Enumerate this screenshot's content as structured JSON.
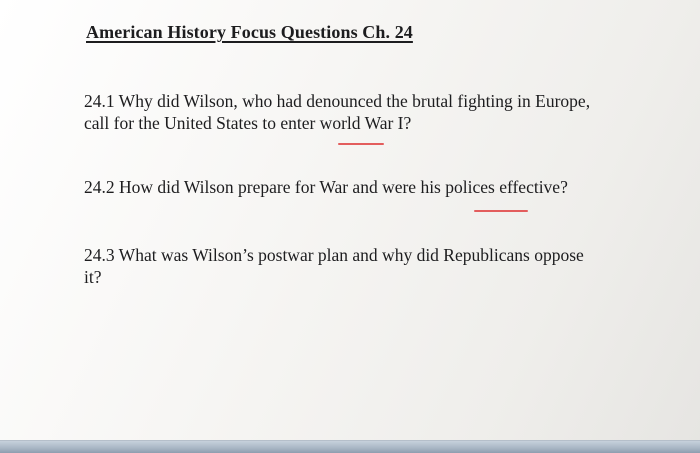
{
  "document": {
    "title": "American History Focus Questions Ch. 24",
    "questions": [
      {
        "text_line1": "24.1 Why did Wilson, who had denounced the brutal fighting in Europe,",
        "text_line2": "call for the United States to enter world War I?"
      },
      {
        "text_line1": "24.2 How did Wilson prepare for War and were his polices effective?"
      },
      {
        "text_line1": "24.3 What was Wilson’s postwar plan and why did Republicans oppose",
        "text_line2": "it?"
      }
    ]
  },
  "colors": {
    "spellcheck_underline": "#e35d5d",
    "text": "#1d1d1f",
    "bottom_bar": "#a8b6c4"
  }
}
